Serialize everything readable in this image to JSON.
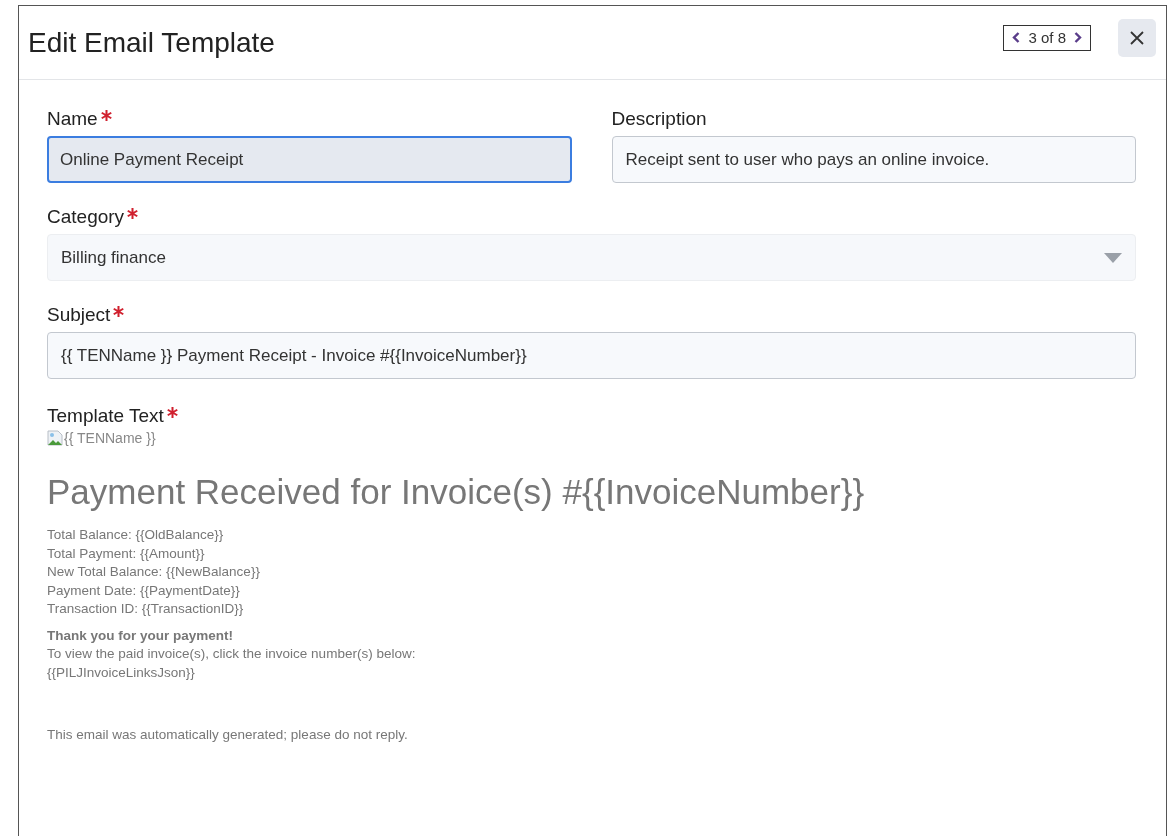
{
  "window": {
    "title": "Edit Email Template"
  },
  "pager": {
    "text": "3 of 8"
  },
  "field_rows": [
    [
      {
        "kind": "text",
        "label": "Name",
        "required": true,
        "value": "Online Payment Receipt",
        "focused": true
      },
      {
        "kind": "text",
        "label": "Description",
        "required": false,
        "value": "Receipt sent to user who pays an online invoice.",
        "focused": false
      }
    ],
    [
      {
        "kind": "select",
        "label": "Category",
        "required": true,
        "value": "Billing finance",
        "focused": false
      }
    ],
    [
      {
        "kind": "text",
        "label": "Subject",
        "required": true,
        "value": "{{ TENName }} Payment Receipt - Invoice #{{InvoiceNumber}}",
        "focused": false
      }
    ]
  ],
  "template_text": {
    "label": "Template Text",
    "required": true,
    "image_alt": "{{ TENName }}",
    "heading": "Payment Received for Invoice(s) #{{InvoiceNumber}}",
    "lines": [
      "Total Balance: {{OldBalance}}",
      "Total Payment: {{Amount}}",
      "New Total Balance: {{NewBalance}}",
      "Payment Date: {{PaymentDate}}",
      "Transaction ID: {{TransactionID}}"
    ],
    "thanks": "Thank you for your payment!",
    "instructions": "To view the paid invoice(s), click the invoice number(s) below:",
    "links_placeholder": "{{PILJInvoiceLinksJson}}",
    "footer": "This email was automatically generated; please do not reply."
  }
}
